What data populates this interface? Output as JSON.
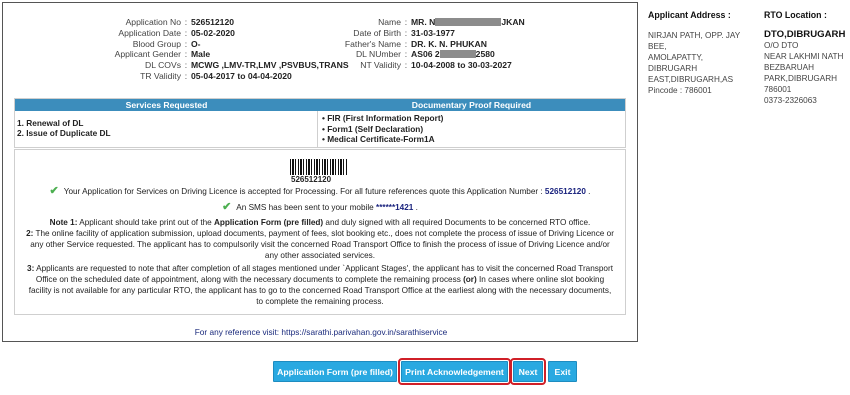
{
  "applicant": {
    "left": [
      {
        "label": "Application No",
        "value": "526512120"
      },
      {
        "label": "Application Date",
        "value": "05-02-2020"
      },
      {
        "label": "Blood Group",
        "value": "O-"
      },
      {
        "label": "Applicant Gender",
        "value": "Male"
      },
      {
        "label": "DL COVs",
        "value": "MCWG ,LMV-TR,LMV ,PSVBUS,TRANS"
      },
      {
        "label": "TR Validity",
        "value": "05-04-2017 to 04-04-2020"
      }
    ],
    "right": [
      {
        "label": "Name",
        "value_pre": "MR. N",
        "value_post": "JKAN"
      },
      {
        "label": "Date of Birth",
        "value": "31-03-1977"
      },
      {
        "label": "Father's Name",
        "value": "DR. K. N. PHUKAN"
      },
      {
        "label": "DL NUmber",
        "value_pre": "AS06 2",
        "value_post": "2580"
      },
      {
        "label": "NT Validity",
        "value": "10-04-2008 to 30-03-2027"
      }
    ]
  },
  "services": {
    "header_services": "Services Requested",
    "header_docs": "Documentary Proof Required",
    "items": [
      "1. Renewal of DL",
      "2. Issue of Duplicate DL"
    ],
    "docs": [
      "• FIR (First Information Report)",
      "• Form1 (Self Declaration)",
      "• Medical Certificate-Form1A"
    ]
  },
  "ack": {
    "barcode_number": "526512120",
    "accepted_text": "Your Application for Services on Driving Licence is accepted for Processing. For all future references quote this Application Number : ",
    "accepted_number": "526512120",
    "accepted_suffix": " .",
    "sms_text": "An SMS has been sent to your mobile ",
    "sms_number": "******1421",
    "sms_suffix": " .",
    "note1_label": "Note 1:",
    "note1_pre": " Applicant should take print out of the ",
    "note1_bold": "Application Form (pre filled)",
    "note1_post": " and duly signed with all required Documents to be concerned RTO office.",
    "note2_label": "2:",
    "note2_text": " The online facility of application submission, upload documents, payment of fees, slot booking etc., does not complete the process of issue of Driving Licence or any other Service requested. The applicant has to compulsorily visit the concerned Road Transport Office to finish the process of issue of Driving Licence and/or any other associated services.",
    "note3_label": "3:",
    "note3_pre": " Applicants are requested to note that after completion of all stages mentioned under `Applicant Stages', the applicant has to visit the concerned Road Transport Office on the scheduled date of appointment, along with the necessary documents to complete the remaining process ",
    "note3_bold": "(or)",
    "note3_post": " In cases where online slot booking facility is not available for any particular RTO, the applicant has to go to the concerned Road Transport Office at the earliest along with the necessary documents, to complete the remaining process."
  },
  "reference": "For any reference visit: https://sarathi.parivahan.gov.in/sarathiservice",
  "sidebar": {
    "applicant_address_title": "Applicant Address :",
    "applicant_address_lines": [
      "NIRJAN PATH, OPP. JAY",
      "BEE,",
      "AMOLAPATTY,",
      "DIBRUGARH",
      "EAST,DIBRUGARH,AS",
      "Pincode : 786001"
    ],
    "rto_title": "RTO Location :",
    "rto_name": "DTO,DIBRUGARH",
    "rto_lines": [
      "O/O DTO",
      "NEAR LAKHMI NATH",
      "BEZBARUAH",
      "PARK,DIBRUGARH",
      "786001",
      "0373-2326063"
    ]
  },
  "buttons": {
    "application_form": "Application Form (pre filled)",
    "print_ack": "Print Acknowledgement",
    "next": "Next",
    "exit": "Exit"
  },
  "colors": {
    "button_bg": "#29a9e1",
    "header_bg": "#3c8dbc",
    "highlight": "#d01f27",
    "check": "#4caf50"
  }
}
